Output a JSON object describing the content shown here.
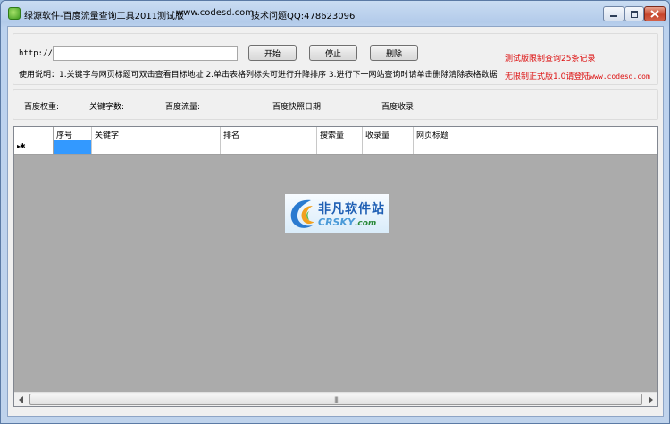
{
  "window": {
    "title": "绿源软件-百度流量查询工具2011测试版",
    "website": "www.codesd.com",
    "support": "技术问题QQ:478623096"
  },
  "query": {
    "url_label": "http://",
    "url_value": "",
    "start_label": "开始",
    "stop_label": "停止",
    "delete_label": "删除",
    "usage_text": "使用说明：1.关键字与网页标题可双击查看目标地址 2.单击表格列标头可进行升降排序 3.进行下一网站查询时请单击删除清除表格数据",
    "notice_limit": "测试版限制查询25条记录",
    "notice_full_prefix": "无限制正式版1.0请登陆",
    "notice_full_site": "www.codesd.com"
  },
  "stats": {
    "weight_label": "百度权重:",
    "keywords_label": "关键字数:",
    "traffic_label": "百度流量:",
    "snapshot_label": "百度快照日期:",
    "indexed_label": "百度收录:"
  },
  "grid": {
    "columns": [
      "序号",
      "关键字",
      "排名",
      "搜索量",
      "收录量",
      "网页标题"
    ],
    "new_row_marker": "▸✱"
  },
  "watermark": {
    "name": "非凡软件站",
    "brand": "CRSKY",
    "domain": ".com"
  },
  "scrollbar": {
    "grip": "|||"
  },
  "colors": {
    "notice": "#dd1111",
    "selection": "#3399ff",
    "grid_empty": "#ababab"
  }
}
